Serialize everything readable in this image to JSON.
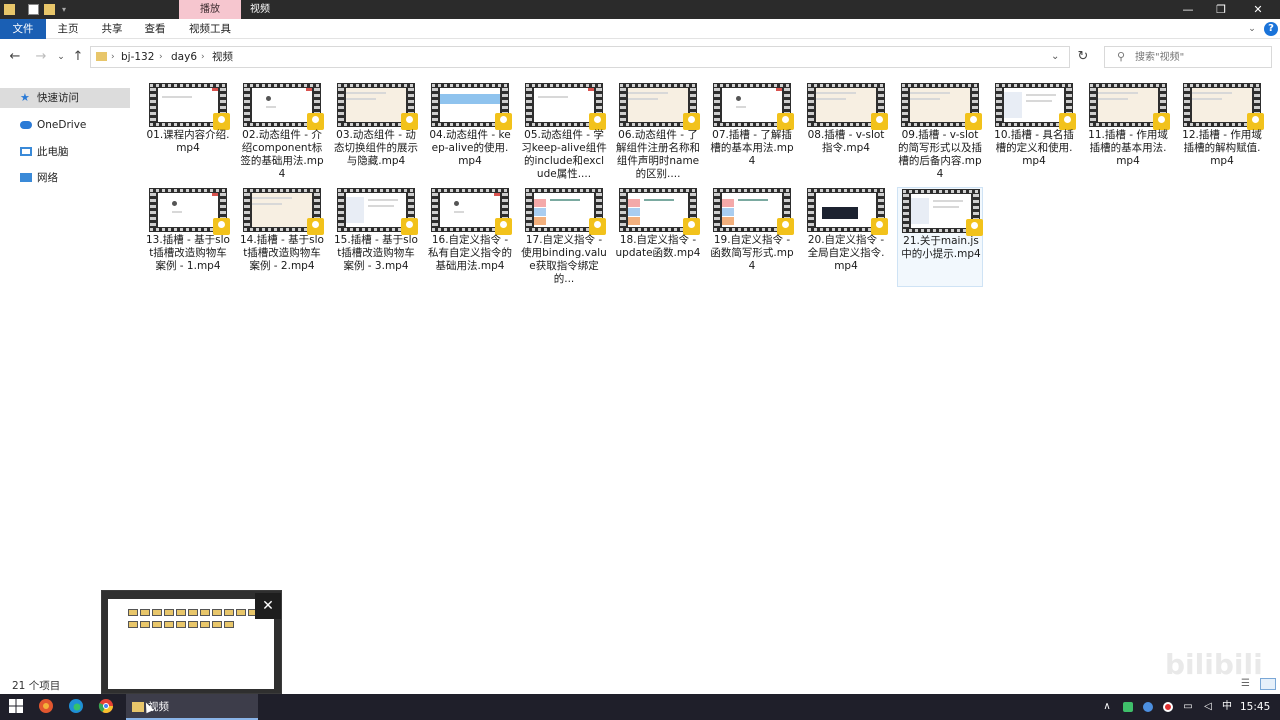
{
  "window": {
    "title": "视频",
    "context_tab": "播放",
    "controls": [
      "—",
      "❐",
      "✕"
    ]
  },
  "ribbon": {
    "tabs": [
      "文件",
      "主页",
      "共享",
      "查看",
      "视频工具"
    ],
    "help": "?"
  },
  "address": {
    "crumbs": [
      "bj-132",
      "day6",
      "视频"
    ],
    "search_placeholder": "搜索\"视频\""
  },
  "sidebar": {
    "items": [
      {
        "label": "快速访问",
        "icon": "star-icon"
      },
      {
        "label": "OneDrive",
        "icon": "cloud-icon"
      },
      {
        "label": "此电脑",
        "icon": "computer-icon"
      },
      {
        "label": "网络",
        "icon": "network-icon"
      }
    ]
  },
  "files": [
    "01.课程内容介绍.mp4",
    "02.动态组件 - 介绍component标签的基础用法.mp4",
    "03.动态组件 - 动态切换组件的展示与隐藏.mp4",
    "04.动态组件 - keep-alive的使用.mp4",
    "05.动态组件 - 学习keep-alive组件的include和exclude属性....",
    "06.动态组件 - 了解组件注册名称和组件声明时name的区别....",
    "07.插槽 - 了解插槽的基本用法.mp4",
    "08.插槽 - v-slot指令.mp4",
    "09.插槽 - v-slot的简写形式以及插槽的后备内容.mp4",
    "10.插槽 - 具名插槽的定义和使用.mp4",
    "11.插槽 - 作用域插槽的基本用法.mp4",
    "12.插槽 - 作用域插槽的解构赋值.mp4",
    "13.插槽 - 基于slot插槽改造购物车案例 - 1.mp4",
    "14.插槽 - 基于slot插槽改造购物车案例 - 2.mp4",
    "15.插槽 - 基于slot插槽改造购物车案例 - 3.mp4",
    "16.自定义指令 - 私有自定义指令的基础用法.mp4",
    "17.自定义指令 - 使用binding.value获取指令绑定的...",
    "18.自定义指令 - update函数.mp4",
    "19.自定义指令 - 函数简写形式.mp4",
    "20.自定义指令 - 全局自定义指令.mp4",
    "21.关于main.js中的小提示.mp4"
  ],
  "status": {
    "count": "21 个项目"
  },
  "taskbar": {
    "explorer_label": "视频",
    "clock": "15:45",
    "ime": "中"
  },
  "colors": {
    "titlebar": "#2b2b2b",
    "context_tab": "#f6c6cf",
    "file_tab": "#1a5fb4",
    "badge": "#f2c21b",
    "taskbar": "#1f1f2a"
  }
}
